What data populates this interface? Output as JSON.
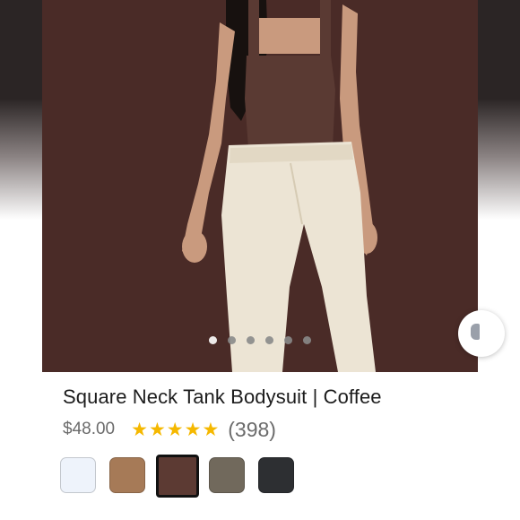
{
  "product": {
    "title": "Square Neck Tank Bodysuit | Coffee",
    "price": "$48.00",
    "rating": 5,
    "rating_max": 5,
    "review_count": "(398)"
  },
  "carousel": {
    "total": 6,
    "active_index": 0
  },
  "swatches": [
    {
      "color": "#eef3fb",
      "selected": false
    },
    {
      "color": "#a67a57",
      "selected": false
    },
    {
      "color": "#5c3a33",
      "selected": true
    },
    {
      "color": "#71695c",
      "selected": false
    },
    {
      "color": "#2d2f32",
      "selected": false
    }
  ],
  "colors": {
    "star": "#f5b800",
    "hero_background": "#4a2b27"
  },
  "icons": {
    "side_button": "hanger-icon",
    "star": "star-icon"
  }
}
